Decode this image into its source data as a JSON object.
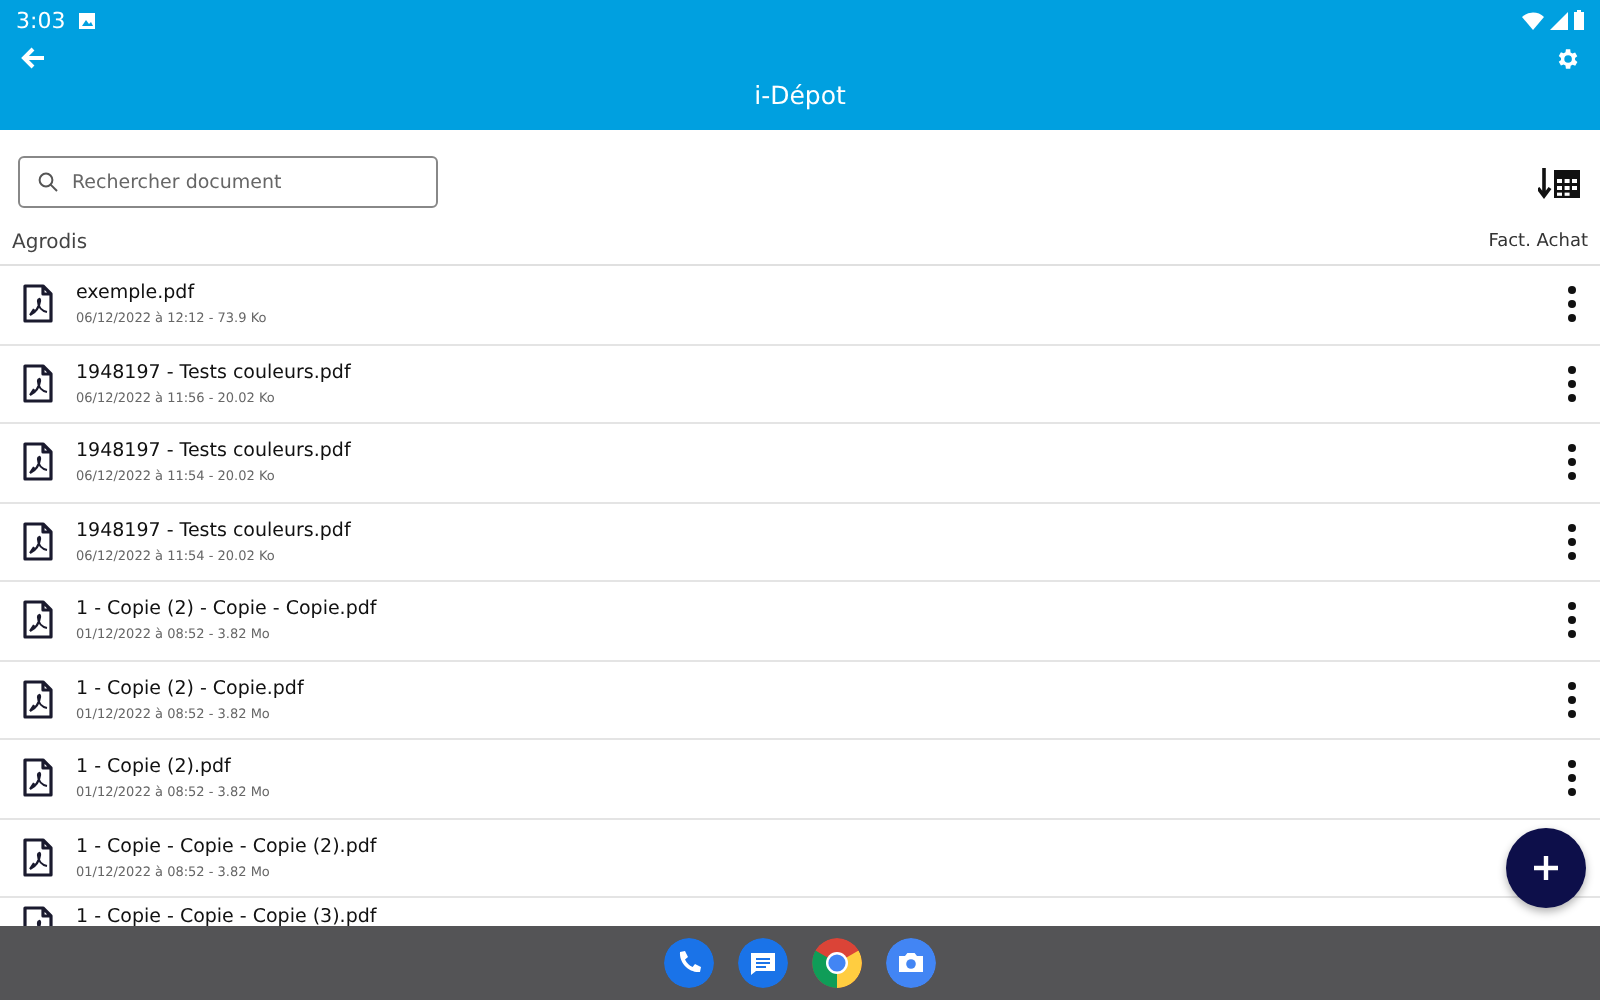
{
  "status_bar": {
    "time": "3:03"
  },
  "toolbar": {
    "title": "i-Dépot"
  },
  "search": {
    "placeholder": "Rechercher document"
  },
  "list_header": {
    "group": "Agrodis",
    "category": "Fact. Achat"
  },
  "documents": [
    {
      "name": "exemple.pdf",
      "details": "06/12/2022 à 12:12 - 73.9 Ko"
    },
    {
      "name": "1948197 - Tests couleurs.pdf",
      "details": "06/12/2022 à 11:56 - 20.02 Ko"
    },
    {
      "name": "1948197 - Tests couleurs.pdf",
      "details": "06/12/2022 à 11:54 - 20.02 Ko"
    },
    {
      "name": "1948197 - Tests couleurs.pdf",
      "details": "06/12/2022 à 11:54 - 20.02 Ko"
    },
    {
      "name": "1 - Copie (2) - Copie - Copie.pdf",
      "details": "01/12/2022 à 08:52 - 3.82 Mo"
    },
    {
      "name": "1 - Copie (2) - Copie.pdf",
      "details": "01/12/2022 à 08:52 - 3.82 Mo"
    },
    {
      "name": "1 - Copie (2).pdf",
      "details": "01/12/2022 à 08:52 - 3.82 Mo"
    },
    {
      "name": "1 - Copie - Copie - Copie (2).pdf",
      "details": "01/12/2022 à 08:52 - 3.82 Mo"
    },
    {
      "name": "1 - Copie - Copie - Copie (3).pdf"
    }
  ]
}
